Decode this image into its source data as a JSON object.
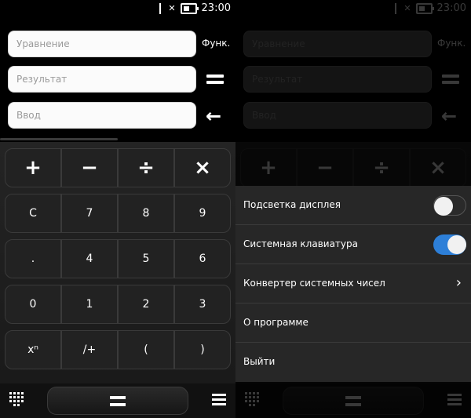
{
  "status": {
    "time": "23:00"
  },
  "calculator": {
    "equation_placeholder": "Уравнение",
    "result_placeholder": "Результат",
    "input_placeholder": "Ввод",
    "func_label": "Функ.",
    "back_icon": "←",
    "keys": [
      [
        "+",
        "−",
        "÷",
        "×"
      ],
      [
        "C",
        "7",
        "8",
        "9"
      ],
      [
        ".",
        "4",
        "5",
        "6"
      ],
      [
        "0",
        "1",
        "2",
        "3"
      ],
      [
        "xⁿ",
        "/+",
        "(",
        ")"
      ]
    ]
  },
  "menu": {
    "items": [
      {
        "label": "Подсветка дисплея",
        "control": "toggle",
        "on": false
      },
      {
        "label": "Системная клавиатура",
        "control": "toggle",
        "on": true
      },
      {
        "label": "Конвертер системных чисел",
        "control": "chevron"
      },
      {
        "label": "О программе"
      },
      {
        "label": "Выйти"
      }
    ],
    "chevron": "›",
    "toggle_on_color": "#2d7fd8"
  },
  "icons": {
    "signal": "signal-off-icon",
    "battery": "battery-icon",
    "keypad": "keypad-icon",
    "equals": "equals-icon",
    "menu": "menu-icon",
    "back": "back-arrow-icon"
  }
}
